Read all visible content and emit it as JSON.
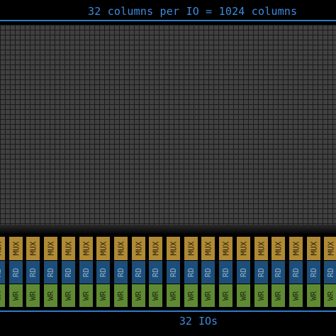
{
  "title": "32 columns per IO = 1024 columns",
  "footer": "32 IOs",
  "io_block_labels": {
    "mux": "MUX",
    "rd": "RD",
    "wr": "WR"
  },
  "colors": {
    "accent": "#3c8cdc",
    "grid_cell": "#404040",
    "mux": "#b08a34",
    "rd": "#1d4e79",
    "wr": "#5f8a33"
  }
}
